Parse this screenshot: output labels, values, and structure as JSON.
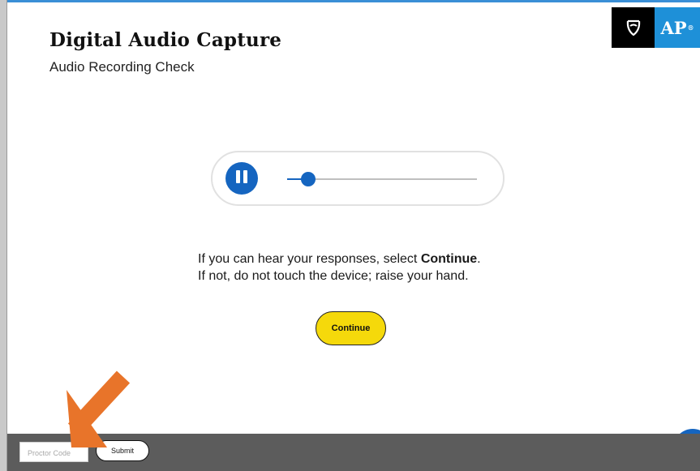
{
  "header": {
    "title": "Digital Audio Capture",
    "subtitle": "Audio Recording Check",
    "logo_text": "AP",
    "logo_mark": "®"
  },
  "player": {
    "state": "playing",
    "control_icon": "pause-icon",
    "progress": 0.11
  },
  "instructions": {
    "line1_prefix": "If you can hear your responses, select ",
    "line1_bold": "Continue",
    "line1_suffix": ".",
    "line2": "If not, do not touch the device; raise your hand."
  },
  "actions": {
    "continue_label": "Continue"
  },
  "footer": {
    "proctor_placeholder": "Proctor Code",
    "proctor_value": "",
    "submit_label": "Submit"
  },
  "colors": {
    "accent_blue": "#1565c0",
    "logo_blue": "#1e90d8",
    "continue_yellow": "#f5d90b",
    "footer_gray": "#5c5c5c",
    "annotation_arrow": "#e8742a"
  }
}
